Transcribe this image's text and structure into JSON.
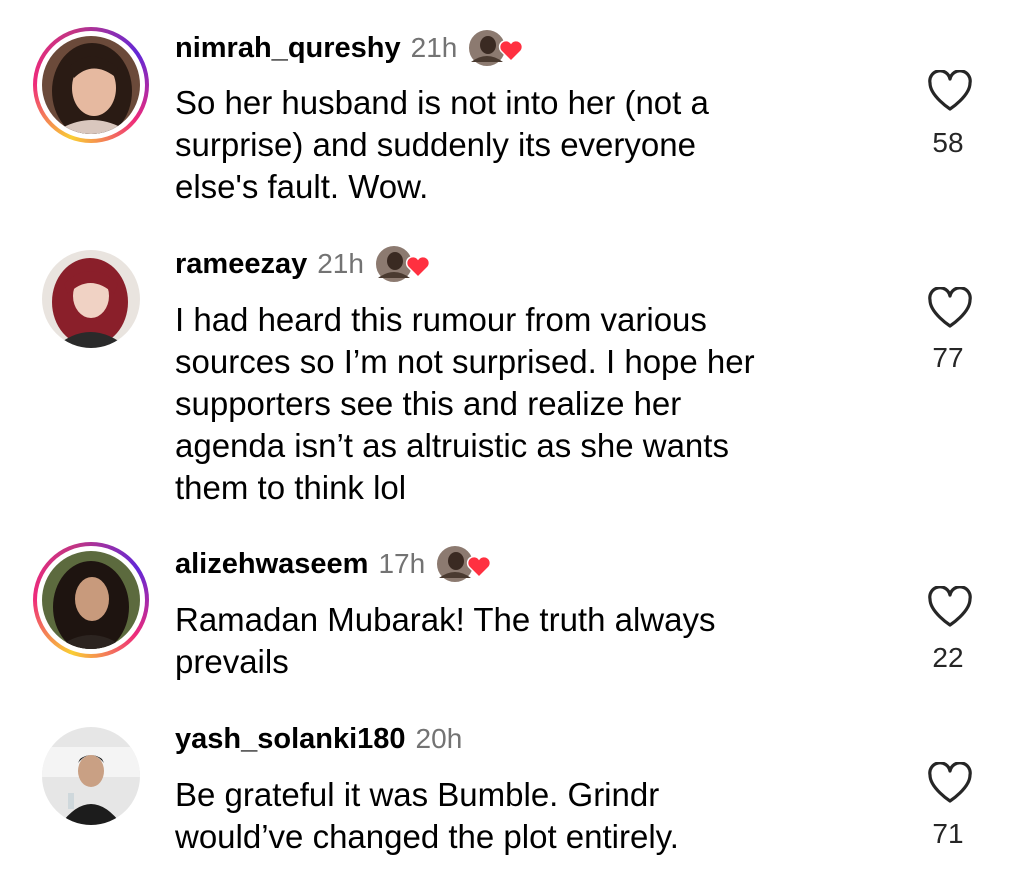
{
  "comments": [
    {
      "username": "nimrah_qureshy",
      "time": "21h",
      "text_lines": [
        "So her husband is not into her (not a",
        "surprise) and suddenly its everyone",
        "else's fault. Wow."
      ],
      "likes": "58",
      "has_story": true,
      "liked_by_author": true
    },
    {
      "username": "rameezay",
      "time": "21h",
      "text_lines": [
        "I had heard this rumour from various",
        "sources so I’m not surprised. I hope her",
        "supporters see this and realize her",
        "agenda isn’t as altruistic as she wants",
        "them to think lol"
      ],
      "likes": "77",
      "has_story": false,
      "liked_by_author": true
    },
    {
      "username": "alizehwaseem",
      "time": "17h",
      "text_lines": [
        "Ramadan Mubarak! The truth always",
        "prevails"
      ],
      "likes": "22",
      "has_story": true,
      "liked_by_author": true
    },
    {
      "username": "yash_solanki180",
      "time": "20h",
      "text_lines": [
        "Be grateful it was Bumble. Grindr",
        "would’ve changed the plot entirely."
      ],
      "likes": "71",
      "has_story": false,
      "liked_by_author": false
    }
  ],
  "colors": {
    "liked_heart": "#ff3040",
    "muted_text": "#737373",
    "story_ring": [
      "#f9ce34",
      "#ee2a7b",
      "#6228d7"
    ]
  },
  "icons": {
    "like": "heart-outline-icon",
    "author_like": "creator-liked-heart-icon"
  }
}
